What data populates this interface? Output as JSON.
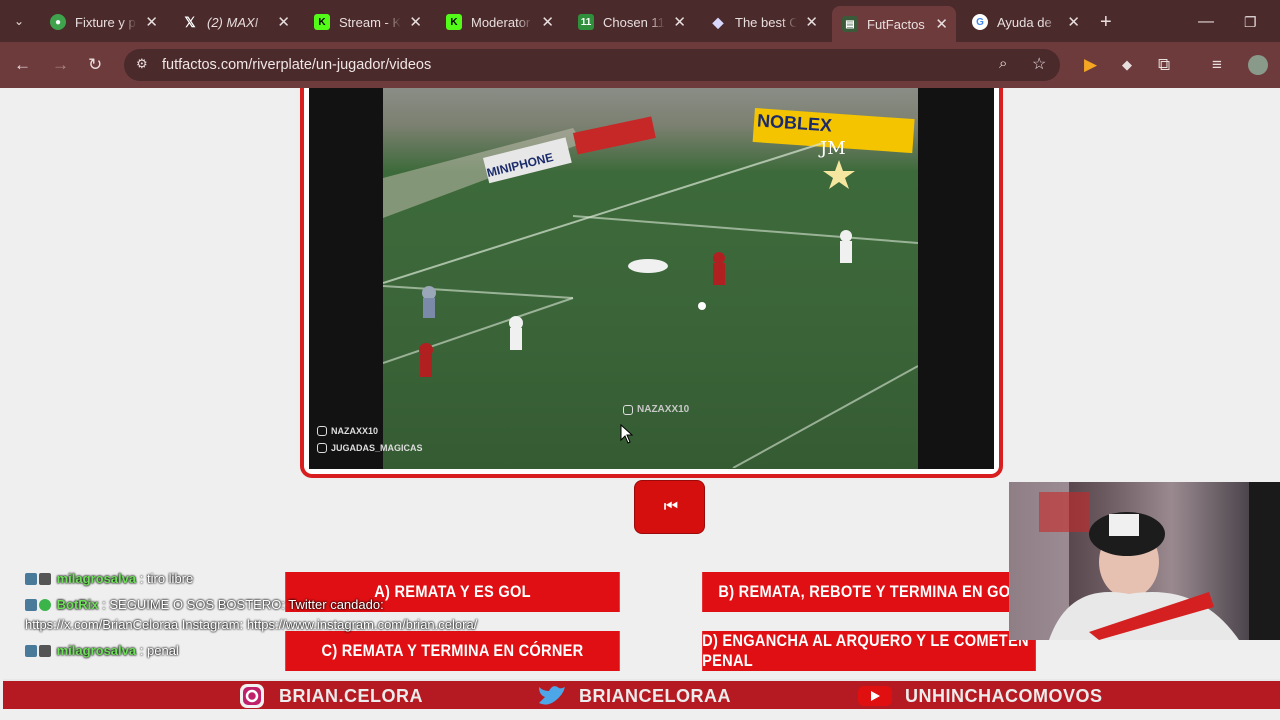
{
  "browser": {
    "tabs": [
      {
        "title": "Fixture y p",
        "icon": "soccer-ball-icon",
        "color": "#3fa34d"
      },
      {
        "title": "(2) MAXI",
        "icon": "x-logo-icon",
        "color": "#222222"
      },
      {
        "title": "Stream - K",
        "icon": "kick-logo-icon",
        "color": "#53fc18"
      },
      {
        "title": "Moderator",
        "icon": "kick-logo-icon",
        "color": "#53fc18"
      },
      {
        "title": "Chosen 11",
        "icon": "eleven-logo-icon",
        "color": "#2f8f3a"
      },
      {
        "title": "The best C",
        "icon": "diamond-icon",
        "color": "#6a6aff"
      },
      {
        "title": "FutFactos",
        "icon": "futfactos-icon",
        "color": "#3a5a3a"
      },
      {
        "title": "Ayuda de",
        "icon": "google-icon",
        "color": "#ffffff"
      }
    ],
    "url": "futfactos.com/riverplate/un-jugador/videos"
  },
  "video": {
    "watermark_center": "NAZAXX10",
    "watermark_left_1": "NAZAXX10",
    "watermark_left_2": "JUGADAS_MAGICAS",
    "sponsor_1": "NOBLEX",
    "sponsor_2": "MINIPHONE",
    "corner_mark": "JM"
  },
  "controls": {
    "rewind_icon": "rewind-to-start-icon"
  },
  "options": {
    "a": "A) REMATA Y ES GOL",
    "b": "B) REMATA, REBOTE Y TERMINA EN GOL",
    "c": "C) REMATA Y TERMINA EN CÓRNER",
    "d": "D) ENGANCHA AL ARQUERO Y LE COMETEN PENAL"
  },
  "chat": {
    "messages": [
      {
        "user": "milagrosalva",
        "sep": ":",
        "text": "tiro libre"
      },
      {
        "user": "BotRix",
        "sep": ":",
        "text": "SEGUIME O SOS BOSTERO: Twitter candado:",
        "cont": "https://x.com/BrianCeloraa Instagram: https://www.instagram.com/brian.celora/"
      },
      {
        "user": "milagrosalva",
        "sep": ":",
        "text": "penal"
      }
    ]
  },
  "footer": {
    "instagram": "BRIAN.CELORA",
    "twitter": "BRIANCELORAA",
    "youtube": "UNHINCHACOMOVOS"
  }
}
